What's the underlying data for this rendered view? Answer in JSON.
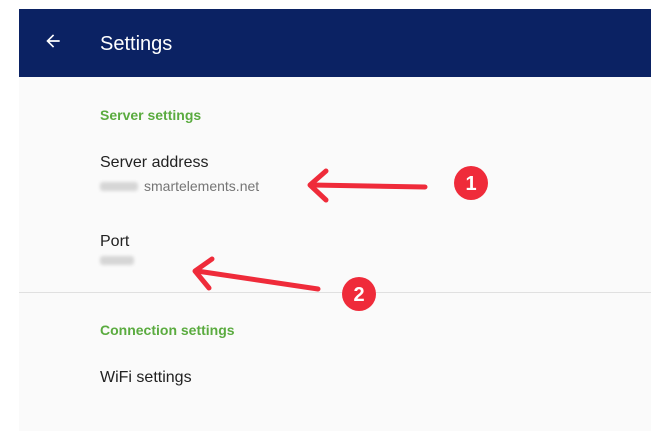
{
  "appbar": {
    "title": "Settings",
    "back_icon": "arrow-back-icon",
    "background": "#0b2263"
  },
  "sections": [
    {
      "header": "Server settings",
      "items": [
        {
          "title": "Server address",
          "summary_suffix": "smartelements.net"
        },
        {
          "title": "Port",
          "summary_suffix": ""
        }
      ]
    },
    {
      "header": "Connection settings",
      "items": [
        {
          "title": "WiFi settings"
        }
      ]
    }
  ],
  "annotations": [
    {
      "number": "1",
      "points_to": "server-address-summary"
    },
    {
      "number": "2",
      "points_to": "port-summary"
    }
  ],
  "colors": {
    "section_header": "#5aab3f",
    "annotation_red": "#ef2b3a"
  }
}
